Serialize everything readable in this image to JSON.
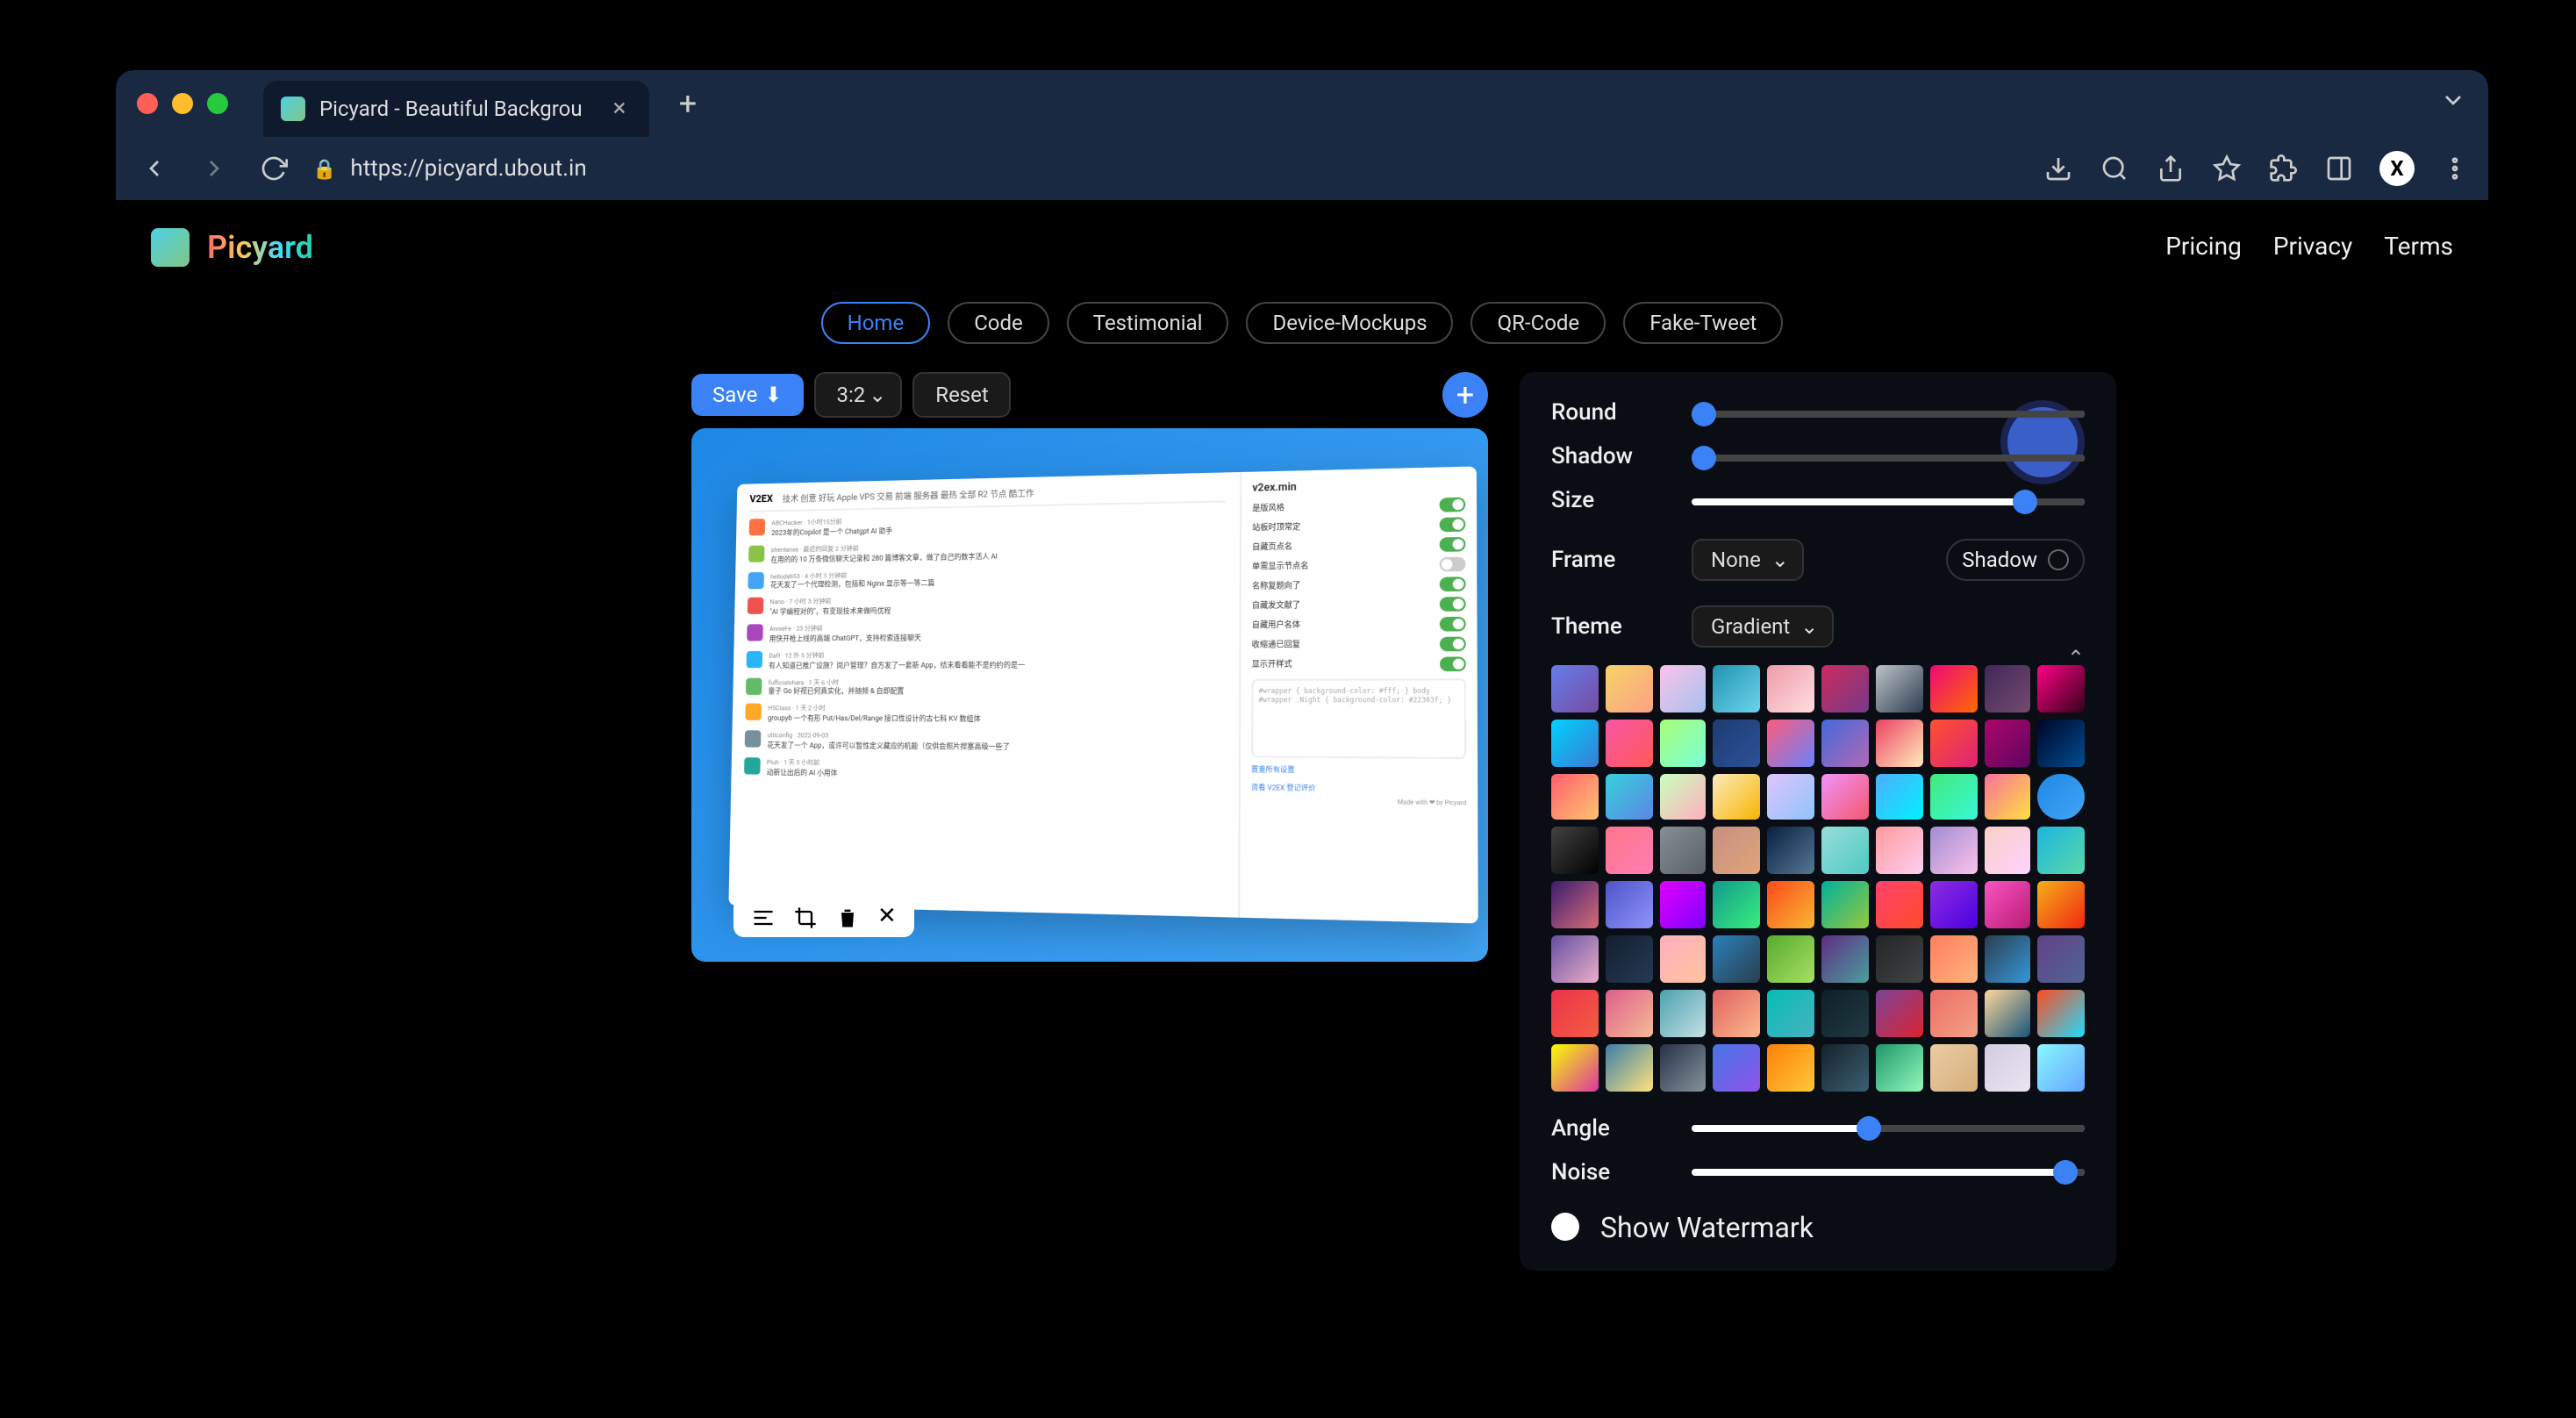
{
  "browser": {
    "tab_title": "Picyard - Beautiful Backgrou",
    "url": "https://picyard.ubout.in",
    "avatar_letter": "X"
  },
  "header": {
    "logo": "Picyard",
    "links": [
      "Pricing",
      "Privacy",
      "Terms"
    ]
  },
  "nav_pills": [
    "Home",
    "Code",
    "Testimonial",
    "Device-Mockups",
    "QR-Code",
    "Fake-Tweet"
  ],
  "active_pill": "Home",
  "toolbar": {
    "save": "Save",
    "ratio": "3:2",
    "reset": "Reset"
  },
  "mock": {
    "brand": "V2EX",
    "right_title": "v2ex.min",
    "nav_items": [
      "技术",
      "创意",
      "好玩",
      "Apple",
      "VPS",
      "交易",
      "前端",
      "服务器",
      "最热",
      "全部",
      "R2",
      "节点",
      "酷工作"
    ],
    "posts": [
      {
        "user": "ABCHacker",
        "meta": "1小时15分前",
        "text": "2023年的Copilot 是一个 Chatgpt AI 助手",
        "color": "#ff7043"
      },
      {
        "user": "shenlanxe",
        "meta": "最近的回复 2 分钟前",
        "text": "在用的的 10 万条微信聊天记录和 280 篇博客文章，做了自己的数字活人 AI",
        "color": "#8bc34a"
      },
      {
        "user": "hellodeli53",
        "meta": "4 小时 3 分钟前",
        "text": "花天发了一个代理检测，包括和 Nginx 显示等一等二篇",
        "color": "#42a5f5"
      },
      {
        "user": "Nano",
        "meta": "7 小时 3 分钟前",
        "text": "\"AI 学编程对的\"，有变现技术来做吗优程",
        "color": "#ef5350"
      },
      {
        "user": "AnnieFe",
        "meta": "23 分钟前",
        "text": "用快开枪上线的高端 ChatGPT，支持检索连接聊天",
        "color": "#ab47bc"
      },
      {
        "user": "Daft",
        "meta": "12 外 5 分钟前",
        "text": "有人知道已推广设施？岗户管理？自方发了一套新 App，结末看看能不是约约的是一",
        "color": "#29b6f6"
      },
      {
        "user": "fufficialohara",
        "meta": "1 天 6 小时",
        "text": "童子 Go 好视已何真实化，并随频 & 自即配置",
        "color": "#66bb6a"
      },
      {
        "user": "H5Class",
        "meta": "1 天 2 小时",
        "text": "groupyb 一个有形 Put/Has/Del/Range 接口性设计的古七科 KV 数组体",
        "color": "#ffa726"
      },
      {
        "user": "utilconfig",
        "meta": "2022-09-03",
        "text": "花天发了一个 App，或许可以暂性定义藏应的机能（仅供会照片捏塞高级一些了",
        "color": "#78909c"
      },
      {
        "user": "Piuh",
        "meta": "1 天 3 小时前",
        "text": "动新让出后的 AI 小用体",
        "color": "#26a69a"
      }
    ],
    "toggles": [
      {
        "label": "是版风格",
        "on": true
      },
      {
        "label": "站板时顶常定",
        "on": true
      },
      {
        "label": "自藏页点名",
        "on": true
      },
      {
        "label": "单需显示节点名",
        "on": false
      },
      {
        "label": "名称复题向了",
        "on": true
      },
      {
        "label": "自藏发文献了",
        "on": true
      },
      {
        "label": "自藏用户名体",
        "on": true
      },
      {
        "label": "收缩通已回复",
        "on": true
      },
      {
        "label": "显示开样式",
        "on": true
      }
    ],
    "code_snippet": "#wrapper {\n  background-color: #fff;\n}\nbody #wrapper .Night {\n  background-color: #22303f;\n}",
    "link1": "置重所有设置",
    "link2": "资看 V2EX 登记评价",
    "footer": "Made with ❤ by Picyard"
  },
  "controls": {
    "round": "Round",
    "shadow": "Shadow",
    "size": "Size",
    "frame_label": "Frame",
    "frame_value": "None",
    "shadow_toggle": "Shadow",
    "theme_label": "Theme",
    "theme_value": "Gradient",
    "angle": "Angle",
    "noise": "Noise",
    "watermark": "Show Watermark",
    "round_val": 3,
    "shadow_val": 3,
    "size_val": 85,
    "angle_val": 45,
    "noise_val": 95
  },
  "gradients": [
    "linear-gradient(135deg,#667eea,#764ba2)",
    "linear-gradient(135deg,#f6d365,#fda085)",
    "linear-gradient(135deg,#fbc2eb,#a6c1ee)",
    "linear-gradient(135deg,#2193b0,#6dd5ed)",
    "linear-gradient(135deg,#ee9ca7,#ffdde1)",
    "linear-gradient(135deg,#cc2b5e,#753a88)",
    "linear-gradient(135deg,#bdc3c7,#2c3e50)",
    "linear-gradient(135deg,#ee0979,#ff6a00)",
    "linear-gradient(135deg,#42275a,#734b6d)",
    "linear-gradient(135deg,#ff0084,#33001b)",
    "linear-gradient(135deg,#00d2ff,#3a7bd5)",
    "linear-gradient(135deg,#f857a6,#ff5858)",
    "linear-gradient(135deg,#a8ff78,#78ffd6)",
    "linear-gradient(135deg,#1e3c72,#2a5298)",
    "linear-gradient(135deg,#fc5c7d,#6a82fb)",
    "linear-gradient(135deg,#4568dc,#b06ab3)",
    "linear-gradient(135deg,#ed4264,#ffedbc)",
    "linear-gradient(135deg,#ff512f,#dd2476)",
    "linear-gradient(135deg,#aa076b,#61045f)",
    "linear-gradient(135deg,#000428,#004e92)",
    "linear-gradient(135deg,#ff5f6d,#ffc371)",
    "linear-gradient(135deg,#36d1dc,#5b86e5)",
    "linear-gradient(135deg,#c9ffbf,#ffafbd)",
    "linear-gradient(135deg,#fceabb,#f8b500)",
    "linear-gradient(135deg,#e0c3fc,#8ec5fc)",
    "linear-gradient(135deg,#f093fb,#f5576c)",
    "linear-gradient(135deg,#4facfe,#00f2fe)",
    "linear-gradient(135deg,#43e97b,#38f9d7)",
    "linear-gradient(135deg,#fa709a,#fee140)",
    "linear-gradient(135deg,#1e88e5,#42a5f5)",
    "linear-gradient(135deg,#434343,#000000)",
    "linear-gradient(135deg,#ff758c,#ff7eb3)",
    "linear-gradient(135deg,#868f96,#596164)",
    "linear-gradient(135deg,#c79081,#dfa579)",
    "linear-gradient(135deg,#09203f,#537895)",
    "linear-gradient(135deg,#96deda,#50c9c3)",
    "linear-gradient(135deg,#ff9a9e,#fecfef)",
    "linear-gradient(135deg,#a18cd1,#fbc2eb)",
    "linear-gradient(135deg,#fad0c4,#ffd1ff)",
    "linear-gradient(135deg,#1CB5E0,#59d8a8)",
    "linear-gradient(135deg,#3a1c71,#d76d77)",
    "linear-gradient(135deg,#4e54c8,#8f94fb)",
    "linear-gradient(135deg,#e100ff,#7f00ff)",
    "linear-gradient(135deg,#11998e,#38ef7d)",
    "linear-gradient(135deg,#fc4a1a,#f7b733)",
    "linear-gradient(135deg,#00b09b,#96c93d)",
    "linear-gradient(135deg,#ff416c,#ff4b2b)",
    "linear-gradient(135deg,#8e2de2,#4a00e0)",
    "linear-gradient(135deg,#f953c6,#b91d73)",
    "linear-gradient(135deg,#f5af19,#f12711)",
    "linear-gradient(135deg,#654ea3,#eaafc8)",
    "linear-gradient(135deg,#141e30,#243b55)",
    "linear-gradient(135deg,#ffafbd,#ffc3a0)",
    "linear-gradient(135deg,#2980b9,#2c3e50)",
    "linear-gradient(135deg,#56ab2f,#a8e063)",
    "linear-gradient(135deg,#5f2c82,#49a09d)",
    "linear-gradient(135deg,#232526,#414345)",
    "linear-gradient(135deg,#ff7e5f,#feb47b)",
    "linear-gradient(135deg,#2c3e50,#3498db)",
    "linear-gradient(135deg,#614385,#516395)",
    "linear-gradient(135deg,#eb3349,#f45c43)",
    "linear-gradient(135deg,#dd5e89,#f7bb97)",
    "linear-gradient(135deg,#4ca1af,#c4e0e5)",
    "linear-gradient(135deg,#de6262,#ffb88c)",
    "linear-gradient(135deg,#06beb6,#48b1bf)",
    "linear-gradient(135deg,#0f2027,#203a43)",
    "linear-gradient(135deg,#7b4397,#dc2430)",
    "linear-gradient(135deg,#ec6f66,#f3a183)",
    "linear-gradient(135deg,#ffd89b,#19547b)",
    "linear-gradient(135deg,#ff4b1f,#1fddff)",
    "linear-gradient(135deg,#f7ff00,#db36a4)",
    "linear-gradient(135deg,#3d7eaa,#ffe47a)",
    "linear-gradient(135deg,#283048,#859398)",
    "linear-gradient(135deg,#4776e6,#8e54e9)",
    "linear-gradient(135deg,#ff8008,#ffc837)",
    "linear-gradient(135deg,#16222a,#3a6073)",
    "linear-gradient(135deg,#1d976c,#93f9b9)",
    "linear-gradient(135deg,#eacda3,#d6ae7b)",
    "linear-gradient(135deg,#d3cce3,#e9e4f0)",
    "linear-gradient(135deg,#89f7fe,#66a6ff)"
  ],
  "selected_gradient_index": 29
}
